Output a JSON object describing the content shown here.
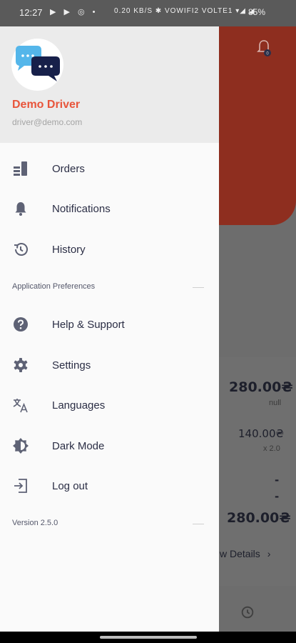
{
  "status_bar": {
    "time": "12:27",
    "left_icons": "▶ ▶ ◎ •",
    "right_text": "0.20 KB/S  ✱  VOWIFI2  VOLTE1  ▾◢ ◢",
    "battery": "85%"
  },
  "drawer": {
    "user": {
      "name": "Demo Driver",
      "email": "driver@demo.com"
    },
    "menu": [
      {
        "label": "Orders",
        "icon": "orders-icon"
      },
      {
        "label": "Notifications",
        "icon": "bell-icon"
      },
      {
        "label": "History",
        "icon": "history-icon"
      }
    ],
    "preferences_label": "Application Preferences",
    "preferences": [
      {
        "label": "Help & Support",
        "icon": "help-icon"
      },
      {
        "label": "Settings",
        "icon": "gear-icon"
      },
      {
        "label": "Languages",
        "icon": "translate-icon"
      },
      {
        "label": "Dark Mode",
        "icon": "brightness-icon"
      },
      {
        "label": "Log out",
        "icon": "logout-icon"
      }
    ],
    "version": "Version 2.5.0"
  },
  "background": {
    "notification_badge": "0",
    "total": "280.00₴",
    "total_note": "null",
    "item_price": "140.00₴",
    "item_qty": "x 2.0",
    "dash1": "-",
    "dash2": "-",
    "grand_total": "280.00₴",
    "details_link": "w Details"
  },
  "colors": {
    "accent": "#e8553b",
    "text_dark": "#2b2e45",
    "icon_grey": "#5e6275",
    "drawer_bg": "#fafafa",
    "header_bg": "#ebebeb"
  }
}
